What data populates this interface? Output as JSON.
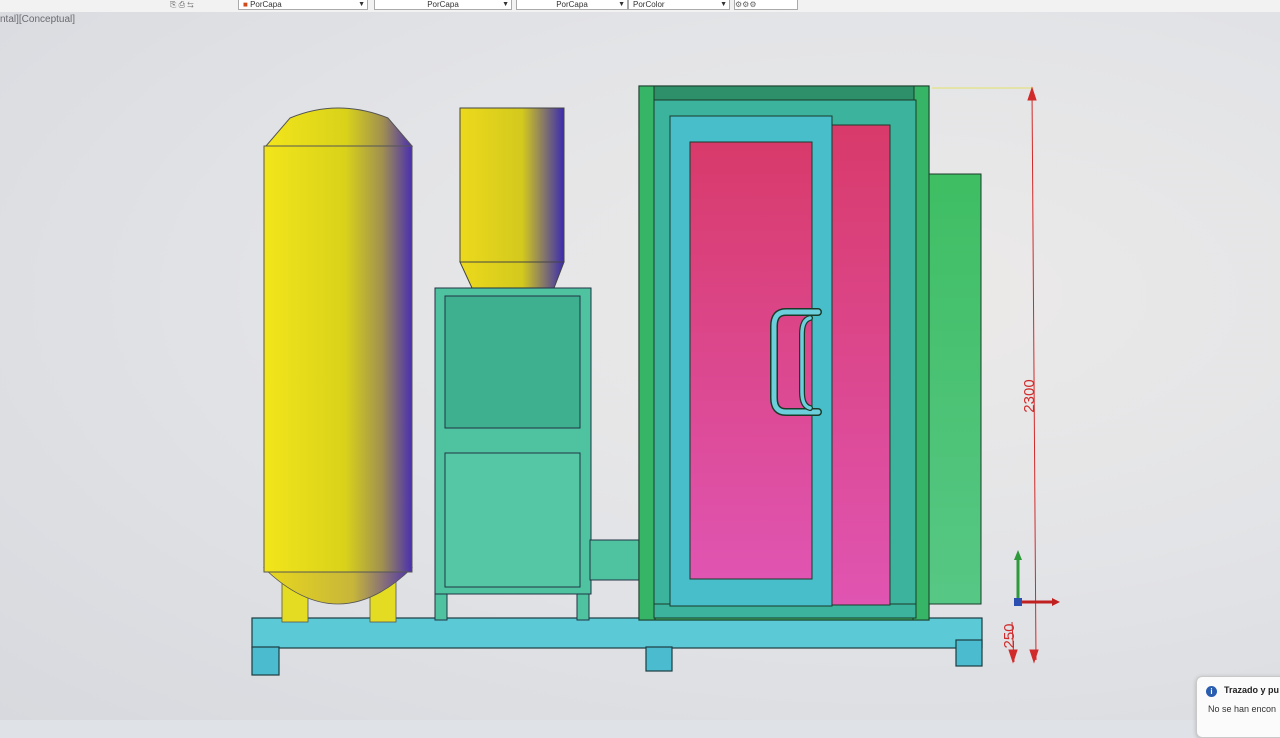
{
  "toolbar": {
    "layer_dropdown": "PorCapa",
    "linetype_dropdown": "PorCapa",
    "lineweight_dropdown": "PorCapa",
    "color_dropdown": "PorColor"
  },
  "viewport": {
    "view_label": "ntal][Conceptual]"
  },
  "dimensions": {
    "overall_height": "2300",
    "base_height": "250"
  },
  "notification": {
    "title": "Trazado y pu",
    "message": "No se han encon"
  },
  "colors": {
    "tank_yellow": "#e8e21a",
    "frame_green": "#3cbf6a",
    "panel_teal": "#53c4a8",
    "base_cyan": "#5cc9d6",
    "door_pink": "#e8428a",
    "dimension_red": "#d12a2a"
  }
}
